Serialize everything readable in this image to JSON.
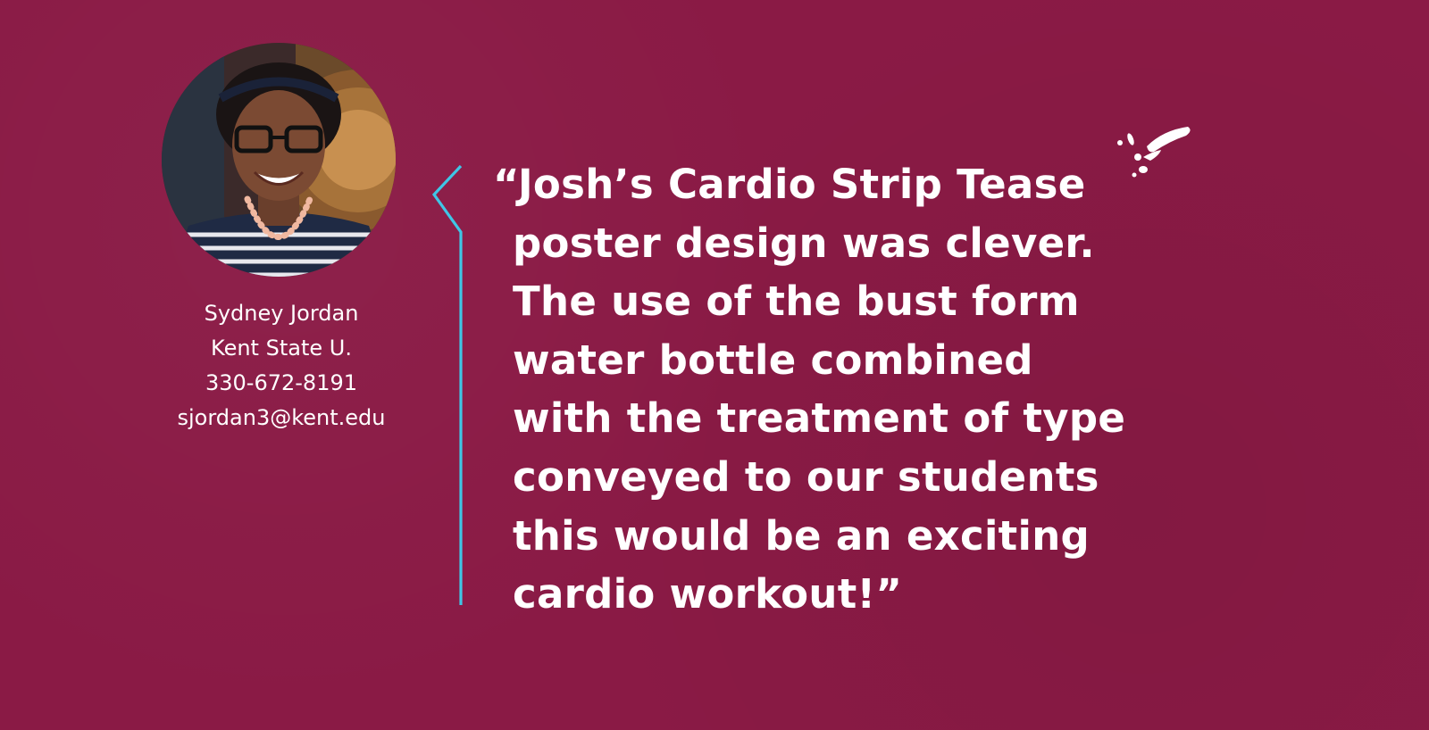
{
  "profile": {
    "name": "Sydney Jordan",
    "affiliation": "Kent State U.",
    "phone": "330-672-8191",
    "email": "sjordan3@kent.edu"
  },
  "quote": {
    "lines": [
      "“Josh’s Cardio Strip Tease",
      "poster design was clever.",
      "The use of the bust form",
      "water bottle combined",
      "with the treatment of type",
      "conveyed to our students",
      "this would be an exciting",
      "cardio workout!”"
    ]
  },
  "colors": {
    "background": "#8a1a45",
    "accent": "#3fc6e6",
    "text": "#ffffff"
  },
  "icons": {
    "bracket": "chevron-bracket-icon",
    "splash": "splash-icon"
  }
}
